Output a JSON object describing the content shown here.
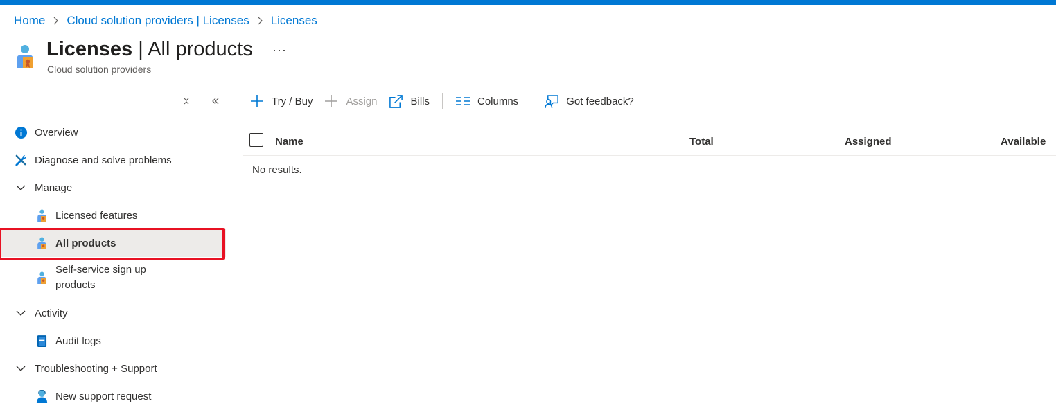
{
  "breadcrumb": {
    "items": [
      "Home",
      "Cloud solution providers | Licenses",
      "Licenses"
    ]
  },
  "header": {
    "title_bold": "Licenses",
    "title_rest": " | All products",
    "subtitle": "Cloud solution providers",
    "more": "···"
  },
  "sidebar": {
    "items": [
      {
        "label": "Overview",
        "icon": "info-icon"
      },
      {
        "label": "Diagnose and solve problems",
        "icon": "wrench-icon"
      },
      {
        "label": "Manage",
        "icon": "chevron-down-icon"
      },
      {
        "label": "Licensed features",
        "icon": "license-user-icon"
      },
      {
        "label": "All products",
        "icon": "license-user-icon"
      },
      {
        "label": "Self-service sign up products",
        "icon": "license-user-icon"
      },
      {
        "label": "Activity",
        "icon": "chevron-down-icon"
      },
      {
        "label": "Audit logs",
        "icon": "book-icon"
      },
      {
        "label": "Troubleshooting + Support",
        "icon": "chevron-down-icon"
      },
      {
        "label": "New support request",
        "icon": "person-support-icon"
      }
    ],
    "selected": "All products"
  },
  "toolbar": {
    "try_buy": "Try / Buy",
    "assign": "Assign",
    "bills": "Bills",
    "columns": "Columns",
    "feedback": "Got feedback?"
  },
  "grid": {
    "columns": [
      "Name",
      "Total",
      "Assigned",
      "Available"
    ],
    "empty_text": "No results."
  },
  "colors": {
    "accent": "#0078d4",
    "selection_highlight": "#e81123",
    "selected_bg": "#edebe9"
  }
}
